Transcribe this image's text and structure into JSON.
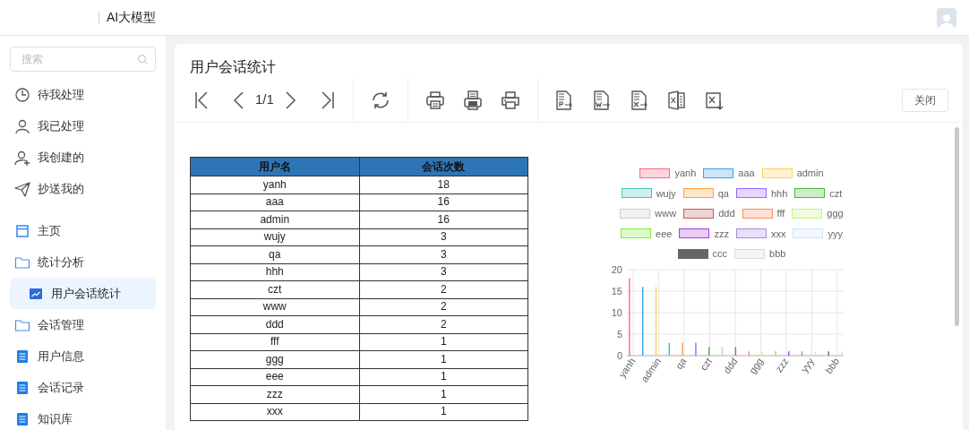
{
  "header": {
    "title": "AI大模型"
  },
  "sidebar": {
    "search": {
      "placeholder": "搜索"
    },
    "items": [
      {
        "kind": "task",
        "label": "待我处理",
        "selected": false
      },
      {
        "kind": "task",
        "label": "我已处理",
        "selected": false
      },
      {
        "kind": "task",
        "label": "我创建的",
        "selected": false
      },
      {
        "kind": "task",
        "label": "抄送我的",
        "selected": false
      },
      {
        "kind": "page",
        "label": "主页",
        "selected": false
      },
      {
        "kind": "folder",
        "label": "统计分析",
        "selected": false,
        "children": [
          {
            "kind": "report",
            "label": "用户会话统计",
            "selected": true
          }
        ]
      },
      {
        "kind": "folder",
        "label": "会话管理",
        "selected": false
      },
      {
        "kind": "page",
        "label": "用户信息",
        "selected": false
      },
      {
        "kind": "page",
        "label": "会话记录",
        "selected": false
      },
      {
        "kind": "page",
        "label": "知识库",
        "selected": false
      }
    ]
  },
  "report": {
    "title": "用户会话统计",
    "page": "1/1",
    "close_button": "关闭",
    "table": {
      "columns": [
        "用户名",
        "会话次数"
      ],
      "rows": [
        [
          "yanh",
          "18"
        ],
        [
          "aaa",
          "16"
        ],
        [
          "admin",
          "16"
        ],
        [
          "wujy",
          "3"
        ],
        [
          "qa",
          "3"
        ],
        [
          "hhh",
          "3"
        ],
        [
          "czt",
          "2"
        ],
        [
          "www",
          "2"
        ],
        [
          "ddd",
          "2"
        ],
        [
          "fff",
          "1"
        ],
        [
          "ggg",
          "1"
        ],
        [
          "eee",
          "1"
        ],
        [
          "zzz",
          "1"
        ],
        [
          "xxx",
          "1"
        ]
      ]
    },
    "chart_data": {
      "type": "bar",
      "categories": [
        "yanh",
        null,
        "admin",
        null,
        "qa",
        null,
        "czt",
        null,
        "ddd",
        null,
        "ggg",
        null,
        "zzz",
        null,
        "yyy",
        null,
        "bbb"
      ],
      "grid": true,
      "legend": "top",
      "ylim": [
        0,
        20
      ],
      "yticks": [
        0,
        5,
        10,
        15,
        20
      ],
      "series": [
        {
          "name": "yanh",
          "color": "#ff6384",
          "values": [
            18,
            null,
            null,
            null,
            null,
            null,
            null,
            null,
            null,
            null,
            null,
            null,
            null,
            null,
            null,
            null,
            null
          ]
        },
        {
          "name": "aaa",
          "color": "#36a2eb",
          "values": [
            null,
            16,
            null,
            null,
            null,
            null,
            null,
            null,
            null,
            null,
            null,
            null,
            null,
            null,
            null,
            null,
            null
          ]
        },
        {
          "name": "admin",
          "color": "#ffce56",
          "values": [
            null,
            null,
            16,
            null,
            null,
            null,
            null,
            null,
            null,
            null,
            null,
            null,
            null,
            null,
            null,
            null,
            null
          ]
        },
        {
          "name": "wujy",
          "color": "#4bc0c0",
          "values": [
            null,
            null,
            null,
            3,
            null,
            null,
            null,
            null,
            null,
            null,
            null,
            null,
            null,
            null,
            null,
            null,
            null
          ]
        },
        {
          "name": "qa",
          "color": "#ff9f40",
          "values": [
            null,
            null,
            null,
            null,
            3,
            null,
            null,
            null,
            null,
            null,
            null,
            null,
            null,
            null,
            null,
            null,
            null
          ]
        },
        {
          "name": "hhh",
          "color": "#9966ff",
          "values": [
            null,
            null,
            null,
            null,
            null,
            3,
            null,
            null,
            null,
            null,
            null,
            null,
            null,
            null,
            null,
            null,
            null
          ]
        },
        {
          "name": "czt",
          "color": "#44bb33",
          "values": [
            null,
            null,
            null,
            null,
            null,
            null,
            2,
            null,
            null,
            null,
            null,
            null,
            null,
            null,
            null,
            null,
            null
          ]
        },
        {
          "name": "www",
          "color": "#c9cbcf",
          "values": [
            null,
            null,
            null,
            null,
            null,
            null,
            null,
            2,
            null,
            null,
            null,
            null,
            null,
            null,
            null,
            null,
            null
          ]
        },
        {
          "name": "ddd",
          "color": "#c45c5c",
          "values": [
            null,
            null,
            null,
            null,
            null,
            null,
            null,
            null,
            2,
            null,
            null,
            null,
            null,
            null,
            null,
            null,
            null
          ]
        },
        {
          "name": "fff",
          "color": "#ff8a65",
          "values": [
            null,
            null,
            null,
            null,
            null,
            null,
            null,
            null,
            null,
            1,
            null,
            null,
            null,
            null,
            null,
            null,
            null
          ]
        },
        {
          "name": "ggg",
          "color": "#c6f57a",
          "values": [
            null,
            null,
            null,
            null,
            null,
            null,
            null,
            null,
            null,
            null,
            1,
            null,
            null,
            null,
            null,
            null,
            null
          ]
        },
        {
          "name": "eee",
          "color": "#80ee33",
          "values": [
            null,
            null,
            null,
            null,
            null,
            null,
            null,
            null,
            null,
            null,
            null,
            1,
            null,
            null,
            null,
            null,
            null
          ]
        },
        {
          "name": "zzz",
          "color": "#a040e0",
          "values": [
            null,
            null,
            null,
            null,
            null,
            null,
            null,
            null,
            null,
            null,
            null,
            null,
            1,
            null,
            null,
            null,
            null
          ]
        },
        {
          "name": "xxx",
          "color": "#a88ad8",
          "values": [
            null,
            null,
            null,
            null,
            null,
            null,
            null,
            null,
            null,
            null,
            null,
            null,
            null,
            1,
            null,
            null,
            null
          ]
        },
        {
          "name": "yyy",
          "color": "#cfe3fb",
          "values": [
            null,
            null,
            null,
            null,
            null,
            null,
            null,
            null,
            null,
            null,
            null,
            null,
            null,
            null,
            1,
            null,
            null
          ]
        },
        {
          "name": "ccc",
          "color": "#666666",
          "values": [
            null,
            null,
            null,
            null,
            null,
            null,
            null,
            null,
            null,
            null,
            null,
            null,
            null,
            null,
            null,
            1,
            null
          ]
        },
        {
          "name": "bbb",
          "color": "#d5dcdc",
          "values": [
            null,
            null,
            null,
            null,
            null,
            null,
            null,
            null,
            null,
            null,
            null,
            null,
            null,
            null,
            null,
            null,
            1
          ]
        }
      ]
    }
  }
}
